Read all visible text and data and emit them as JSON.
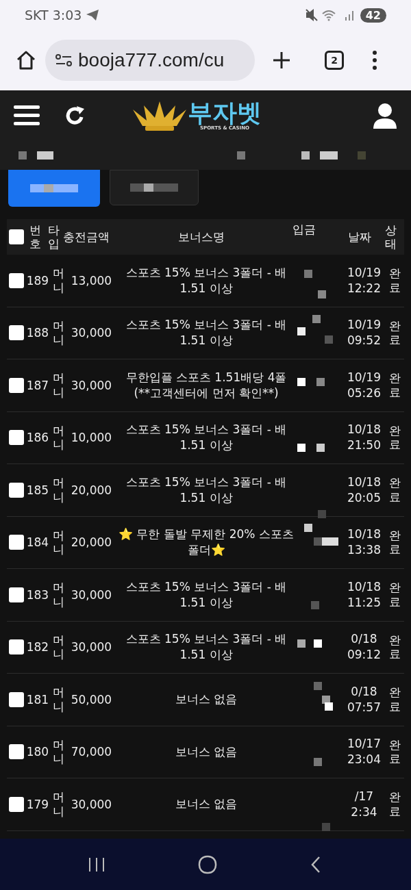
{
  "status_bar": {
    "carrier": "SKT",
    "time": "3:03",
    "battery": "42"
  },
  "browser": {
    "url": "booja777.com/cu",
    "tab_count": "2"
  },
  "site_header": {
    "logo_text": "부자벳",
    "logo_tagline": "SPORTS & CASINO"
  },
  "tabs": [
    {
      "selected": true
    },
    {
      "selected": false
    }
  ],
  "table": {
    "select_all_checked": false,
    "columns": [
      "번호",
      "타입",
      "충전금액",
      "보너스명",
      "입금",
      "날짜",
      "상태"
    ],
    "rows": [
      {
        "checked": false,
        "number": "189",
        "type": "머니",
        "amount": "13,000",
        "bonus": [
          "스포츠 15% 보너스 3폴더 - 배",
          "1.51 이상"
        ],
        "date": "10/19",
        "time": "12:22",
        "status": "완료"
      },
      {
        "checked": false,
        "number": "188",
        "type": "머니",
        "amount": "30,000",
        "bonus": [
          "스포츠 15% 보너스 3폴더 - 배",
          "1.51 이상"
        ],
        "date": "10/19",
        "time": "09:52",
        "status": "완료"
      },
      {
        "checked": false,
        "number": "187",
        "type": "머니",
        "amount": "30,000",
        "bonus": [
          "무한입플 스포츠 1.51배당 4폴",
          "(**고객센터에 먼저 확인**)"
        ],
        "date": "10/19",
        "time": "05:26",
        "status": "완료"
      },
      {
        "checked": false,
        "number": "186",
        "type": "머니",
        "amount": "10,000",
        "bonus": [
          "스포츠 15% 보너스 3폴더 - 배",
          "1.51 이상"
        ],
        "date": "10/18",
        "time": "21:50",
        "status": "완료"
      },
      {
        "checked": false,
        "number": "185",
        "type": "머니",
        "amount": "20,000",
        "bonus": [
          "스포츠 15% 보너스 3폴더 - 배",
          "1.51 이상"
        ],
        "date": "10/18",
        "time": "20:05",
        "status": "완료"
      },
      {
        "checked": false,
        "number": "184",
        "type": "머니",
        "amount": "20,000",
        "bonus": [
          "⭐ 무한 돌발 무제한 20% 스포츠",
          "폴더⭐"
        ],
        "date": "10/18",
        "time": "13:38",
        "status": "완료"
      },
      {
        "checked": false,
        "number": "183",
        "type": "머니",
        "amount": "30,000",
        "bonus": [
          "스포츠 15% 보너스 3폴더 - 배",
          "1.51 이상"
        ],
        "date": "10/18",
        "time": "11:25",
        "status": "완료"
      },
      {
        "checked": false,
        "number": "182",
        "type": "머니",
        "amount": "30,000",
        "bonus": [
          "스포츠 15% 보너스 3폴더 - 배",
          "1.51 이상"
        ],
        "date": "0/18",
        "time": "09:12",
        "status": "완료"
      },
      {
        "checked": false,
        "number": "181",
        "type": "머니",
        "amount": "50,000",
        "bonus": [
          "보너스 없음"
        ],
        "date": "0/18",
        "time": "07:57",
        "status": "완료"
      },
      {
        "checked": false,
        "number": "180",
        "type": "머니",
        "amount": "70,000",
        "bonus": [
          "보너스 없음"
        ],
        "date": "10/17",
        "time": "23:04",
        "status": "완료"
      },
      {
        "checked": false,
        "number": "179",
        "type": "머니",
        "amount": "30,000",
        "bonus": [
          "보너스 없음"
        ],
        "date": "/17",
        "time": "2:34",
        "status": "완료"
      }
    ]
  }
}
